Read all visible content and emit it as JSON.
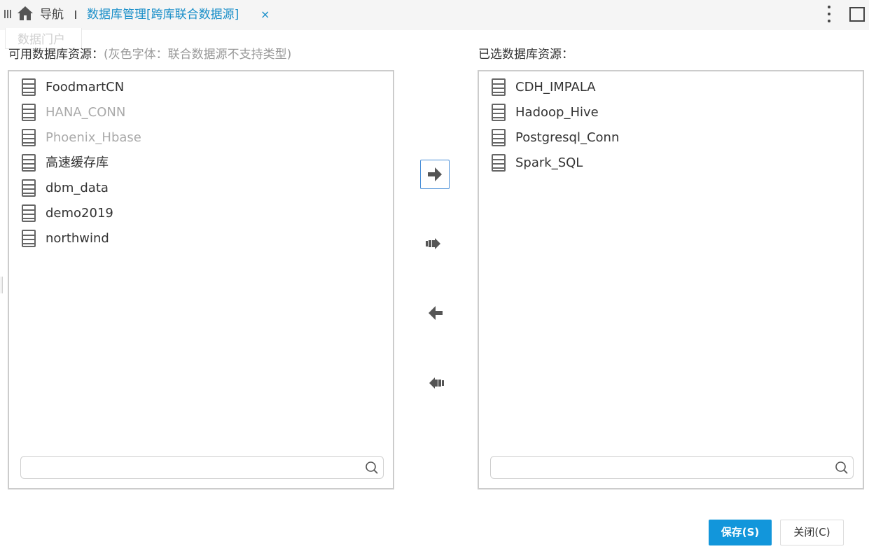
{
  "topbar": {
    "menu_icon": "column-bars-icon",
    "home_icon": "home-icon",
    "nav_label": "导航",
    "tab_title": "数据库管理[跨库联合数据源]",
    "tab_close": "×",
    "more_icon": "vertical-dots-icon",
    "maximize_icon": "square-icon"
  },
  "ghost_tab": {
    "label": "数据门户"
  },
  "available": {
    "label": "可用数据库资源：",
    "hint": "(灰色字体：联合数据源不支持类型)",
    "items": [
      {
        "label": "FoodmartCN",
        "disabled": false
      },
      {
        "label": "HANA_CONN",
        "disabled": true
      },
      {
        "label": "Phoenix_Hbase",
        "disabled": true
      },
      {
        "label": "高速缓存库",
        "disabled": false
      },
      {
        "label": "dbm_data",
        "disabled": false
      },
      {
        "label": "demo2019",
        "disabled": false
      },
      {
        "label": "northwind",
        "disabled": false
      }
    ],
    "search_value": ""
  },
  "selected": {
    "label": "已选数据库资源：",
    "items": [
      {
        "label": "CDH_IMPALA"
      },
      {
        "label": "Hadoop_Hive"
      },
      {
        "label": "Postgresql_Conn"
      },
      {
        "label": "Spark_SQL"
      }
    ],
    "search_value": ""
  },
  "transfer": {
    "move_right_icon": "arrow-right-icon",
    "move_all_right_icon": "double-arrow-right-icon",
    "move_left_icon": "arrow-left-icon",
    "move_all_left_icon": "double-arrow-left-icon"
  },
  "footer": {
    "save_label": "保存(S)",
    "close_label": "关闭(C)"
  },
  "colors": {
    "accent": "#1296db",
    "tab_text": "#1a8fc9",
    "disabled_text": "#aaaaaa",
    "panel_border": "#cccccc"
  }
}
